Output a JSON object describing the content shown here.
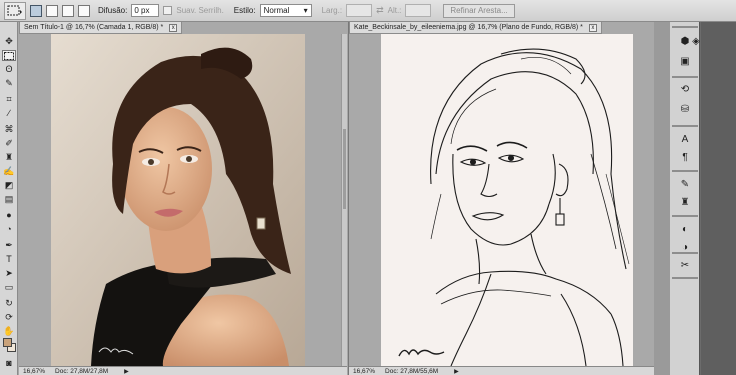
{
  "options_bar": {
    "feather_label": "Difusão:",
    "feather_value": "0 px",
    "antialias_label": "Suav. Serrilh.",
    "style_label": "Estilo:",
    "style_value": "Normal",
    "width_label": "Larg.:",
    "height_label": "Alt.:",
    "refine_edge_label": "Refinar Aresta..."
  },
  "documents": [
    {
      "tab_title": "Sem Título-1 @ 16,7% (Camada 1, RGB/8) *",
      "close_label": "x",
      "zoom": "16,67%",
      "doc_size": "Doc: 27,8M/27,8M",
      "content": "color-photo-portrait"
    },
    {
      "tab_title": "Kate_Beckinsale_by_eileeniema.jpg @ 16,7% (Plano de Fundo, RGB/8) *",
      "close_label": "x",
      "zoom": "16,67%",
      "doc_size": "Doc: 27,8M/55,6M",
      "content": "pencil-sketch-portrait"
    }
  ],
  "tools": [
    "move-tool",
    "marquee-tool",
    "lasso-tool",
    "quick-selection-tool",
    "crop-tool",
    "eyedropper-tool",
    "spot-healing-tool",
    "brush-tool",
    "clone-stamp-tool",
    "history-brush-tool",
    "eraser-tool",
    "gradient-tool",
    "blur-tool",
    "dodge-tool",
    "pen-tool",
    "type-tool",
    "path-selection-tool",
    "rectangle-tool",
    "3d-rotate-tool",
    "3d-orbit-tool",
    "hand-tool",
    "zoom-tool"
  ],
  "colors": {
    "foreground": "#c9a27a",
    "background": "#f0e6d8",
    "ui_panel": "#d6d6d6",
    "workspace": "#a9a9a9"
  }
}
